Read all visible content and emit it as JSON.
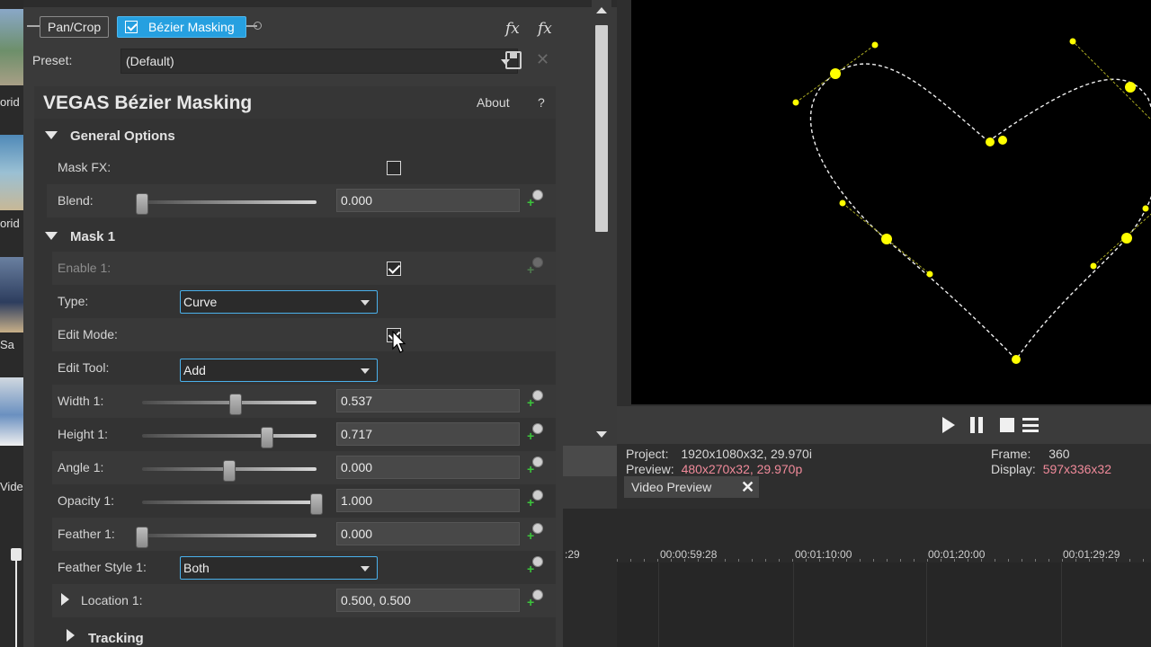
{
  "media_strip": {
    "labels": [
      "orid",
      "orid",
      "Sa",
      "Vide"
    ]
  },
  "fx_chain": {
    "pan_crop": "Pan/Crop",
    "bezier": "Bézier Masking",
    "fx_icon_text": "fx"
  },
  "preset": {
    "label": "Preset:",
    "value": "(Default)"
  },
  "plugin": {
    "title": "VEGAS Bézier Masking",
    "about": "About",
    "help": "?"
  },
  "general": {
    "header": "General Options",
    "mask_fx_label": "Mask FX:",
    "mask_fx_checked": false,
    "blend_label": "Blend:",
    "blend_value": "0.000",
    "blend_fraction": 0.0
  },
  "mask1": {
    "header": "Mask 1",
    "enable_label": "Enable 1:",
    "enable_checked": true,
    "type_label": "Type:",
    "type_value": "Curve",
    "edit_mode_label": "Edit Mode:",
    "edit_mode_checked": true,
    "edit_tool_label": "Edit Tool:",
    "edit_tool_value": "Add",
    "width_label": "Width 1:",
    "width_value": "0.537",
    "width_fraction": 0.537,
    "height_label": "Height 1:",
    "height_value": "0.717",
    "height_fraction": 0.717,
    "angle_label": "Angle 1:",
    "angle_value": "0.000",
    "angle_fraction": 0.5,
    "opacity_label": "Opacity 1:",
    "opacity_value": "1.000",
    "opacity_fraction": 1.0,
    "feather_label": "Feather 1:",
    "feather_value": "0.000",
    "feather_fraction": 0.0,
    "feather_style_label": "Feather Style 1:",
    "feather_style_value": "Both",
    "location_label": "Location 1:",
    "location_value": "0.500, 0.500"
  },
  "tracking": {
    "header": "Tracking"
  },
  "preview_info": {
    "project_label": "Project:",
    "project_value": "1920x1080x32, 29.970i",
    "preview_label": "Preview:",
    "preview_value": "480x270x32, 29.970p",
    "frame_label": "Frame:",
    "frame_value": "360",
    "display_label": "Display:",
    "display_value": "597x336x32",
    "tab_label": "Video Preview",
    "close": "✕"
  },
  "timeline": {
    "labels": [
      ":29",
      "00:00:59:28",
      "00:01:10:00",
      "00:01:20:00",
      "00:01:29:29"
    ]
  },
  "colors": {
    "accent": "#26a0e0",
    "mask_points": "#ffff00",
    "pink_text": "#f08a9a"
  }
}
